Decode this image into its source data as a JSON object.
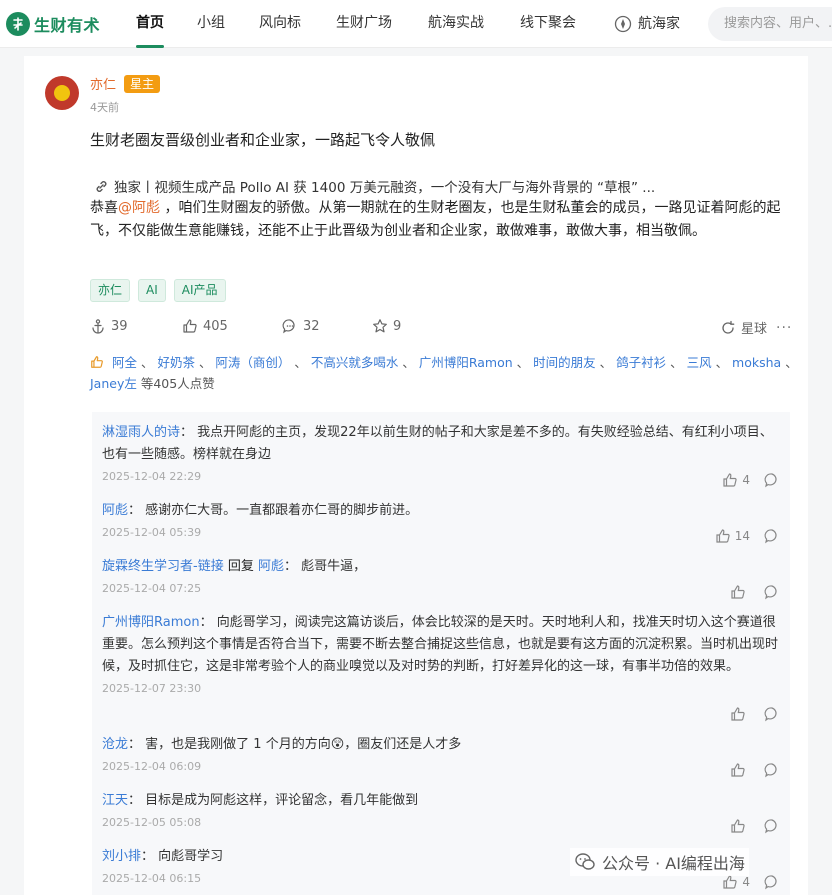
{
  "brand": {
    "name": "生财有术",
    "color": "#1c8c5e"
  },
  "nav": {
    "items": [
      "首页",
      "小组",
      "风向标",
      "生财广场",
      "航海实战",
      "线下聚会"
    ],
    "hanghai": "航海家",
    "search_placeholder": "搜索内容、用户、..."
  },
  "post": {
    "author": "亦仁",
    "badge": "星主",
    "time": "4天前",
    "title": "生财老圈友晋级创业者和企业家，一路起飞令人敬佩",
    "link": "独家丨视频生成产品 Pollo AI 获 1400 万美元融资，一个没有大厂与海外背景的 “草根” ...",
    "body_prefix": "恭喜",
    "body_mention": "@阿彪",
    "body_rest": " ，咱们生财圈友的骄傲。从第一期就在的生财老圈友，也是生财私董会的成员，一路见证着阿彪的起飞，不仅能做生意能赚钱，还能不止于此晋级为创业者和企业家，敢做难事，敢做大事，相当敬佩。",
    "tags": [
      "亦仁",
      "AI",
      "AI产品"
    ],
    "stats": {
      "shares": "39",
      "likes": "405",
      "comments": "32",
      "favorites": "9"
    },
    "star_label": "星球",
    "more": "···",
    "likers": [
      "阿全",
      "好奶茶",
      "阿涛（商创）",
      "不高兴就多喝水",
      "广州博阳Ramon",
      "时间的朋友",
      "鸽子衬衫",
      "三风",
      "moksha",
      "Janey左"
    ],
    "likers_suffix": "等405人点赞"
  },
  "comments": [
    {
      "author": "淋湿雨人的诗",
      "reply_to": "",
      "text": "我点开阿彪的主页，发现22年以前生财的帖子和大家是差不多的。有失败经验总结、有红利小项目、也有一些随感。榜样就在身边",
      "time": "2025-12-04 22:29",
      "likes": "4"
    },
    {
      "author": "阿彪",
      "reply_to": "",
      "text": "感谢亦仁大哥。一直都跟着亦仁哥的脚步前进。",
      "time": "2025-12-04 05:39",
      "likes": "14"
    },
    {
      "author": "旋霖终生学习者-链接",
      "reply_to": "阿彪",
      "reply_label": "回复",
      "text": "彪哥牛逼，",
      "time": "2025-12-04 07:25",
      "likes": ""
    },
    {
      "author": "广州博阳Ramon",
      "reply_to": "",
      "text": "向彪哥学习，阅读完这篇访谈后，体会比较深的是天时。天时地利人和，找准天时切入这个赛道很重要。怎么预判这个事情是否符合当下，需要不断去整合捕捉这些信息，也就是要有这方面的沉淀积累。当时机出现时候，及时抓住它，这是非常考验个人的商业嗅觉以及对时势的判断，打好差异化的这一球，有事半功倍的效果。",
      "time": "2025-12-07 23:30",
      "likes": ""
    },
    {
      "author": "沧龙",
      "reply_to": "",
      "text": "害，也是我刚做了 1 个月的方向😲，圈友们还是人才多",
      "time": "2025-12-04 06:09",
      "likes": ""
    },
    {
      "author": "江天",
      "reply_to": "",
      "text": "目标是成为阿彪这样，评论留念，看几年能做到",
      "time": "2025-12-05 05:08",
      "likes": ""
    },
    {
      "author": "刘小排",
      "reply_to": "",
      "text": "向彪哥学习",
      "time": "2025-12-04 06:15",
      "likes": "4"
    }
  ],
  "watermark": "公众号 · AI编程出海"
}
